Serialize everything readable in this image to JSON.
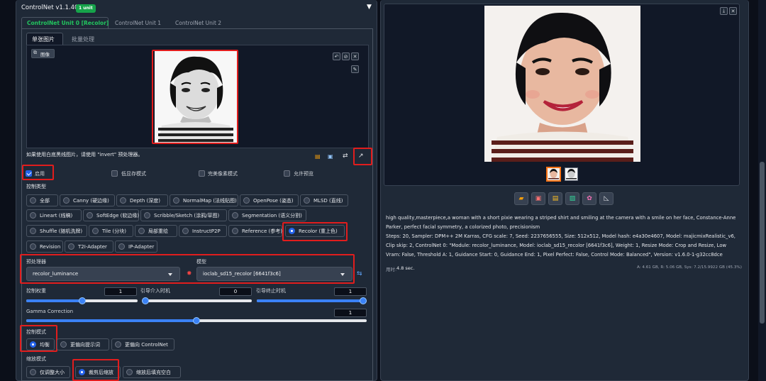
{
  "header": {
    "title": "ControlNet v1.1.406",
    "badge": "1 unit",
    "collapse": "▼"
  },
  "tabs": [
    "ControlNet Unit 0 [Recolor]",
    "ControlNet Unit 1",
    "ControlNet Unit 2"
  ],
  "subtabs": [
    "单张图片",
    "批量处理"
  ],
  "image_panel": {
    "label": "图像",
    "hint": "如果使用白底黑线图片，请使用 \"invert\" 预处理器。"
  },
  "checks": [
    {
      "label": "启用",
      "checked": true
    },
    {
      "label": "低显存模式",
      "checked": false
    },
    {
      "label": "完美像素模式",
      "checked": false
    },
    {
      "label": "允许预览",
      "checked": false
    }
  ],
  "control_type": {
    "title": "控制类型",
    "options": [
      "全部",
      "Canny (硬边缘)",
      "Depth (深度)",
      "NormalMap (法线贴图)",
      "OpenPose (姿态)",
      "MLSD (直线)",
      "Lineart (线稿)",
      "SoftEdge (软边缘)",
      "Scribble/Sketch (涂鸦/草图)",
      "Segmentation (语义分割)",
      "Shuffle (随机洗牌)",
      "Tile (分块)",
      "局部重绘",
      "InstructP2P",
      "Reference (参考)",
      "Recolor (重上色)",
      "Revision",
      "T2I-Adapter",
      "IP-Adapter"
    ],
    "selected": "Recolor (重上色)"
  },
  "preprocessor": {
    "label": "预处理器",
    "value": "recolor_luminance"
  },
  "model": {
    "label": "模型",
    "value": "ioclab_sd15_recolor [6641f3c6]"
  },
  "weight": {
    "label": "控制权重",
    "value": "1",
    "fraction": 0.5
  },
  "start": {
    "label": "引导介入时机",
    "value": "0",
    "fraction": 0
  },
  "end": {
    "label": "引导终止时机",
    "value": "1",
    "fraction": 1
  },
  "gamma": {
    "label": "Gamma Correction",
    "value": "1",
    "fraction": 0.5
  },
  "control_mode": {
    "title": "控制模式",
    "options": [
      "均衡",
      "更偏向提示词",
      "更偏向 ControlNet"
    ],
    "selected": "均衡"
  },
  "resize_mode": {
    "title": "缩放模式",
    "options": [
      "仅调整大小",
      "裁剪后缩放",
      "缩放后填充空白"
    ],
    "selected": "裁剪后缩放"
  },
  "output": {
    "prompt": "high quality,masterpiece,a woman with a short pixie wearing a striped shirt and smiling at the camera with a smile on her face, Constance-Anne Parker, perfect facial symmetry, a colorized photo, precisionism",
    "params": "Steps: 20, Sampler: DPM++ 2M Karras, CFG scale: 7, Seed: 2237656555, Size: 512x512, Model hash: e4a30e4607, Model: majicmixRealistic_v6, Clip skip: 2, ControlNet 0: \"Module: recolor_luminance, Model: ioclab_sd15_recolor [6641f3c6], Weight: 1, Resize Mode: Crop and Resize, Low Vram: False, Threshold A: 1, Guidance Start: 0, Guidance End: 1, Pixel Perfect: False, Control Mode: Balanced\", Version: v1.6.0-1-g32cc8dce",
    "time_label": "用时:",
    "time_value": "4.8 sec.",
    "vram": "A: 4.61 GB, R: 5.06 GB, Sys: 7.2/15.9922 GB (45.3%)"
  },
  "colors": {
    "accent": "#2563eb",
    "highlight": "#e11d1d",
    "bg": "#0b0f19",
    "panel": "#1f2937",
    "badge": "#16a34a"
  }
}
